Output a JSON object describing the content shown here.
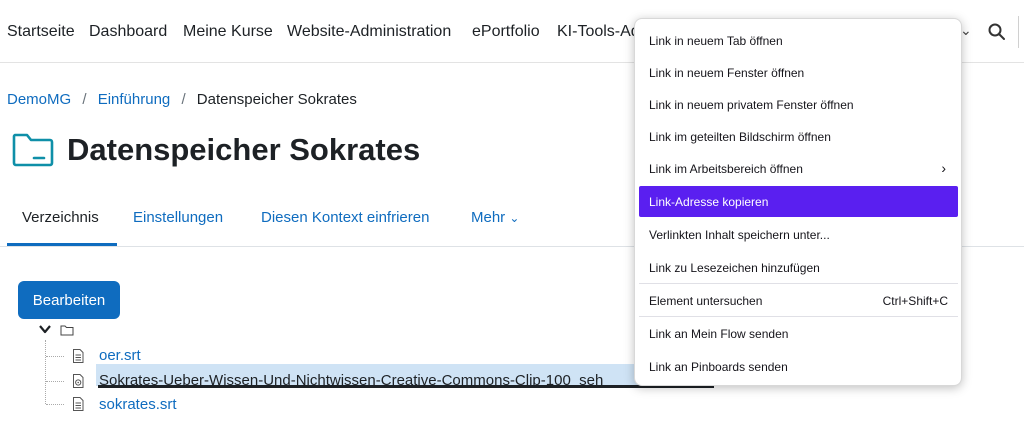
{
  "topnav": {
    "items": [
      "Startseite",
      "Dashboard",
      "Meine Kurse",
      "Website-Administration",
      "ePortfolio",
      "KI-Tools-Ad"
    ]
  },
  "breadcrumb": {
    "items": [
      "DemoMG",
      "Einführung"
    ],
    "current": "Datenspeicher Sokrates",
    "separator": "/"
  },
  "page": {
    "title": "Datenspeicher Sokrates"
  },
  "tabs": {
    "items": [
      "Verzeichnis",
      "Einstellungen",
      "Diesen Kontext einfrieren",
      "Mehr"
    ],
    "more_chevron": "⌄",
    "active": "Verzeichnis"
  },
  "edit_button": {
    "label": "Bearbeiten"
  },
  "files": [
    {
      "name": "oer.srt",
      "icon": "document-icon"
    },
    {
      "name": "Sokrates-Ueber-Wissen-Und-Nichtwissen-Creative-Commons-Clip-100_seh",
      "icon": "media-file-icon",
      "selected": true
    },
    {
      "name": "sokrates.srt",
      "icon": "document-icon"
    }
  ],
  "context_menu": {
    "items": [
      {
        "label": "Link in neuem Tab öffnen"
      },
      {
        "label": "Link in neuem Fenster öffnen"
      },
      {
        "label": "Link in neuem privatem Fenster öffnen"
      },
      {
        "label": "Link im geteilten Bildschirm öffnen"
      },
      {
        "label": "Link im Arbeitsbereich öffnen",
        "submenu": "›"
      },
      {
        "label": "Link-Adresse kopieren",
        "highlighted": true
      },
      {
        "label": "Verlinkten Inhalt speichern unter..."
      },
      {
        "label": "Link zu Lesezeichen hinzufügen"
      },
      {
        "label": "Element untersuchen",
        "shortcut": "Ctrl+Shift+C"
      },
      {
        "label": "Link an Mein Flow senden"
      },
      {
        "label": "Link an Pinboards senden"
      }
    ]
  },
  "colors": {
    "link": "#0f6cbf",
    "primary_button": "#0f6cbf",
    "menu_highlight": "#5a1ff0",
    "selection_bg": "#cfe3f5"
  }
}
